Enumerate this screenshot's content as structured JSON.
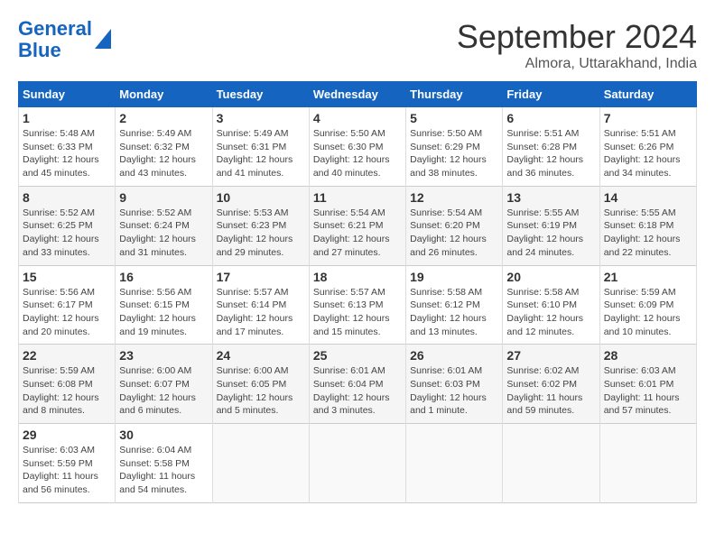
{
  "header": {
    "logo_line1": "General",
    "logo_line2": "Blue",
    "month": "September 2024",
    "location": "Almora, Uttarakhand, India"
  },
  "days_of_week": [
    "Sunday",
    "Monday",
    "Tuesday",
    "Wednesday",
    "Thursday",
    "Friday",
    "Saturday"
  ],
  "weeks": [
    [
      {
        "num": "1",
        "info": "Sunrise: 5:48 AM\nSunset: 6:33 PM\nDaylight: 12 hours\nand 45 minutes."
      },
      {
        "num": "2",
        "info": "Sunrise: 5:49 AM\nSunset: 6:32 PM\nDaylight: 12 hours\nand 43 minutes."
      },
      {
        "num": "3",
        "info": "Sunrise: 5:49 AM\nSunset: 6:31 PM\nDaylight: 12 hours\nand 41 minutes."
      },
      {
        "num": "4",
        "info": "Sunrise: 5:50 AM\nSunset: 6:30 PM\nDaylight: 12 hours\nand 40 minutes."
      },
      {
        "num": "5",
        "info": "Sunrise: 5:50 AM\nSunset: 6:29 PM\nDaylight: 12 hours\nand 38 minutes."
      },
      {
        "num": "6",
        "info": "Sunrise: 5:51 AM\nSunset: 6:28 PM\nDaylight: 12 hours\nand 36 minutes."
      },
      {
        "num": "7",
        "info": "Sunrise: 5:51 AM\nSunset: 6:26 PM\nDaylight: 12 hours\nand 34 minutes."
      }
    ],
    [
      {
        "num": "8",
        "info": "Sunrise: 5:52 AM\nSunset: 6:25 PM\nDaylight: 12 hours\nand 33 minutes."
      },
      {
        "num": "9",
        "info": "Sunrise: 5:52 AM\nSunset: 6:24 PM\nDaylight: 12 hours\nand 31 minutes."
      },
      {
        "num": "10",
        "info": "Sunrise: 5:53 AM\nSunset: 6:23 PM\nDaylight: 12 hours\nand 29 minutes."
      },
      {
        "num": "11",
        "info": "Sunrise: 5:54 AM\nSunset: 6:21 PM\nDaylight: 12 hours\nand 27 minutes."
      },
      {
        "num": "12",
        "info": "Sunrise: 5:54 AM\nSunset: 6:20 PM\nDaylight: 12 hours\nand 26 minutes."
      },
      {
        "num": "13",
        "info": "Sunrise: 5:55 AM\nSunset: 6:19 PM\nDaylight: 12 hours\nand 24 minutes."
      },
      {
        "num": "14",
        "info": "Sunrise: 5:55 AM\nSunset: 6:18 PM\nDaylight: 12 hours\nand 22 minutes."
      }
    ],
    [
      {
        "num": "15",
        "info": "Sunrise: 5:56 AM\nSunset: 6:17 PM\nDaylight: 12 hours\nand 20 minutes."
      },
      {
        "num": "16",
        "info": "Sunrise: 5:56 AM\nSunset: 6:15 PM\nDaylight: 12 hours\nand 19 minutes."
      },
      {
        "num": "17",
        "info": "Sunrise: 5:57 AM\nSunset: 6:14 PM\nDaylight: 12 hours\nand 17 minutes."
      },
      {
        "num": "18",
        "info": "Sunrise: 5:57 AM\nSunset: 6:13 PM\nDaylight: 12 hours\nand 15 minutes."
      },
      {
        "num": "19",
        "info": "Sunrise: 5:58 AM\nSunset: 6:12 PM\nDaylight: 12 hours\nand 13 minutes."
      },
      {
        "num": "20",
        "info": "Sunrise: 5:58 AM\nSunset: 6:10 PM\nDaylight: 12 hours\nand 12 minutes."
      },
      {
        "num": "21",
        "info": "Sunrise: 5:59 AM\nSunset: 6:09 PM\nDaylight: 12 hours\nand 10 minutes."
      }
    ],
    [
      {
        "num": "22",
        "info": "Sunrise: 5:59 AM\nSunset: 6:08 PM\nDaylight: 12 hours\nand 8 minutes."
      },
      {
        "num": "23",
        "info": "Sunrise: 6:00 AM\nSunset: 6:07 PM\nDaylight: 12 hours\nand 6 minutes."
      },
      {
        "num": "24",
        "info": "Sunrise: 6:00 AM\nSunset: 6:05 PM\nDaylight: 12 hours\nand 5 minutes."
      },
      {
        "num": "25",
        "info": "Sunrise: 6:01 AM\nSunset: 6:04 PM\nDaylight: 12 hours\nand 3 minutes."
      },
      {
        "num": "26",
        "info": "Sunrise: 6:01 AM\nSunset: 6:03 PM\nDaylight: 12 hours\nand 1 minute."
      },
      {
        "num": "27",
        "info": "Sunrise: 6:02 AM\nSunset: 6:02 PM\nDaylight: 11 hours\nand 59 minutes."
      },
      {
        "num": "28",
        "info": "Sunrise: 6:03 AM\nSunset: 6:01 PM\nDaylight: 11 hours\nand 57 minutes."
      }
    ],
    [
      {
        "num": "29",
        "info": "Sunrise: 6:03 AM\nSunset: 5:59 PM\nDaylight: 11 hours\nand 56 minutes."
      },
      {
        "num": "30",
        "info": "Sunrise: 6:04 AM\nSunset: 5:58 PM\nDaylight: 11 hours\nand 54 minutes."
      },
      {
        "num": "",
        "info": ""
      },
      {
        "num": "",
        "info": ""
      },
      {
        "num": "",
        "info": ""
      },
      {
        "num": "",
        "info": ""
      },
      {
        "num": "",
        "info": ""
      }
    ]
  ]
}
